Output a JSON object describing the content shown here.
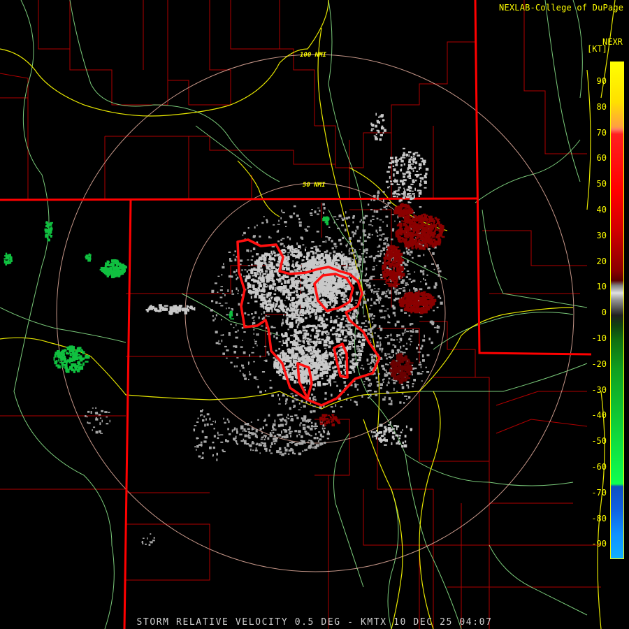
{
  "header": {
    "credit": "NEXLAB-College of DuPage",
    "credit_icon": "external-link-icon",
    "product_code": "NEXR",
    "units": "[KT]"
  },
  "range_rings": [
    {
      "label": "100 NMI"
    },
    {
      "label": "50 NMI"
    }
  ],
  "color_scale": {
    "labels": [
      "90",
      "80",
      "70",
      "60",
      "50",
      "40",
      "30",
      "20",
      "10",
      "0",
      "-10",
      "-20",
      "-30",
      "-40",
      "-50",
      "-60",
      "-70",
      "-80",
      "-90"
    ]
  },
  "caption": "STORM RELATIVE VELOCITY 0.5 DEG - KMTX 10 DEC 25 04:07",
  "colors": {
    "background": "#000000",
    "state_borders": "#ff0000",
    "county_borders": "#b00000",
    "highways": "#ffff00",
    "rivers": "#90ee90",
    "range_rings": "#e8b0a0",
    "warning_polygons": "#ff1010",
    "near_zero_velocity": "#c8c8c8",
    "inbound_velocity": "#10c040",
    "outbound_velocity": "#8b0000"
  }
}
